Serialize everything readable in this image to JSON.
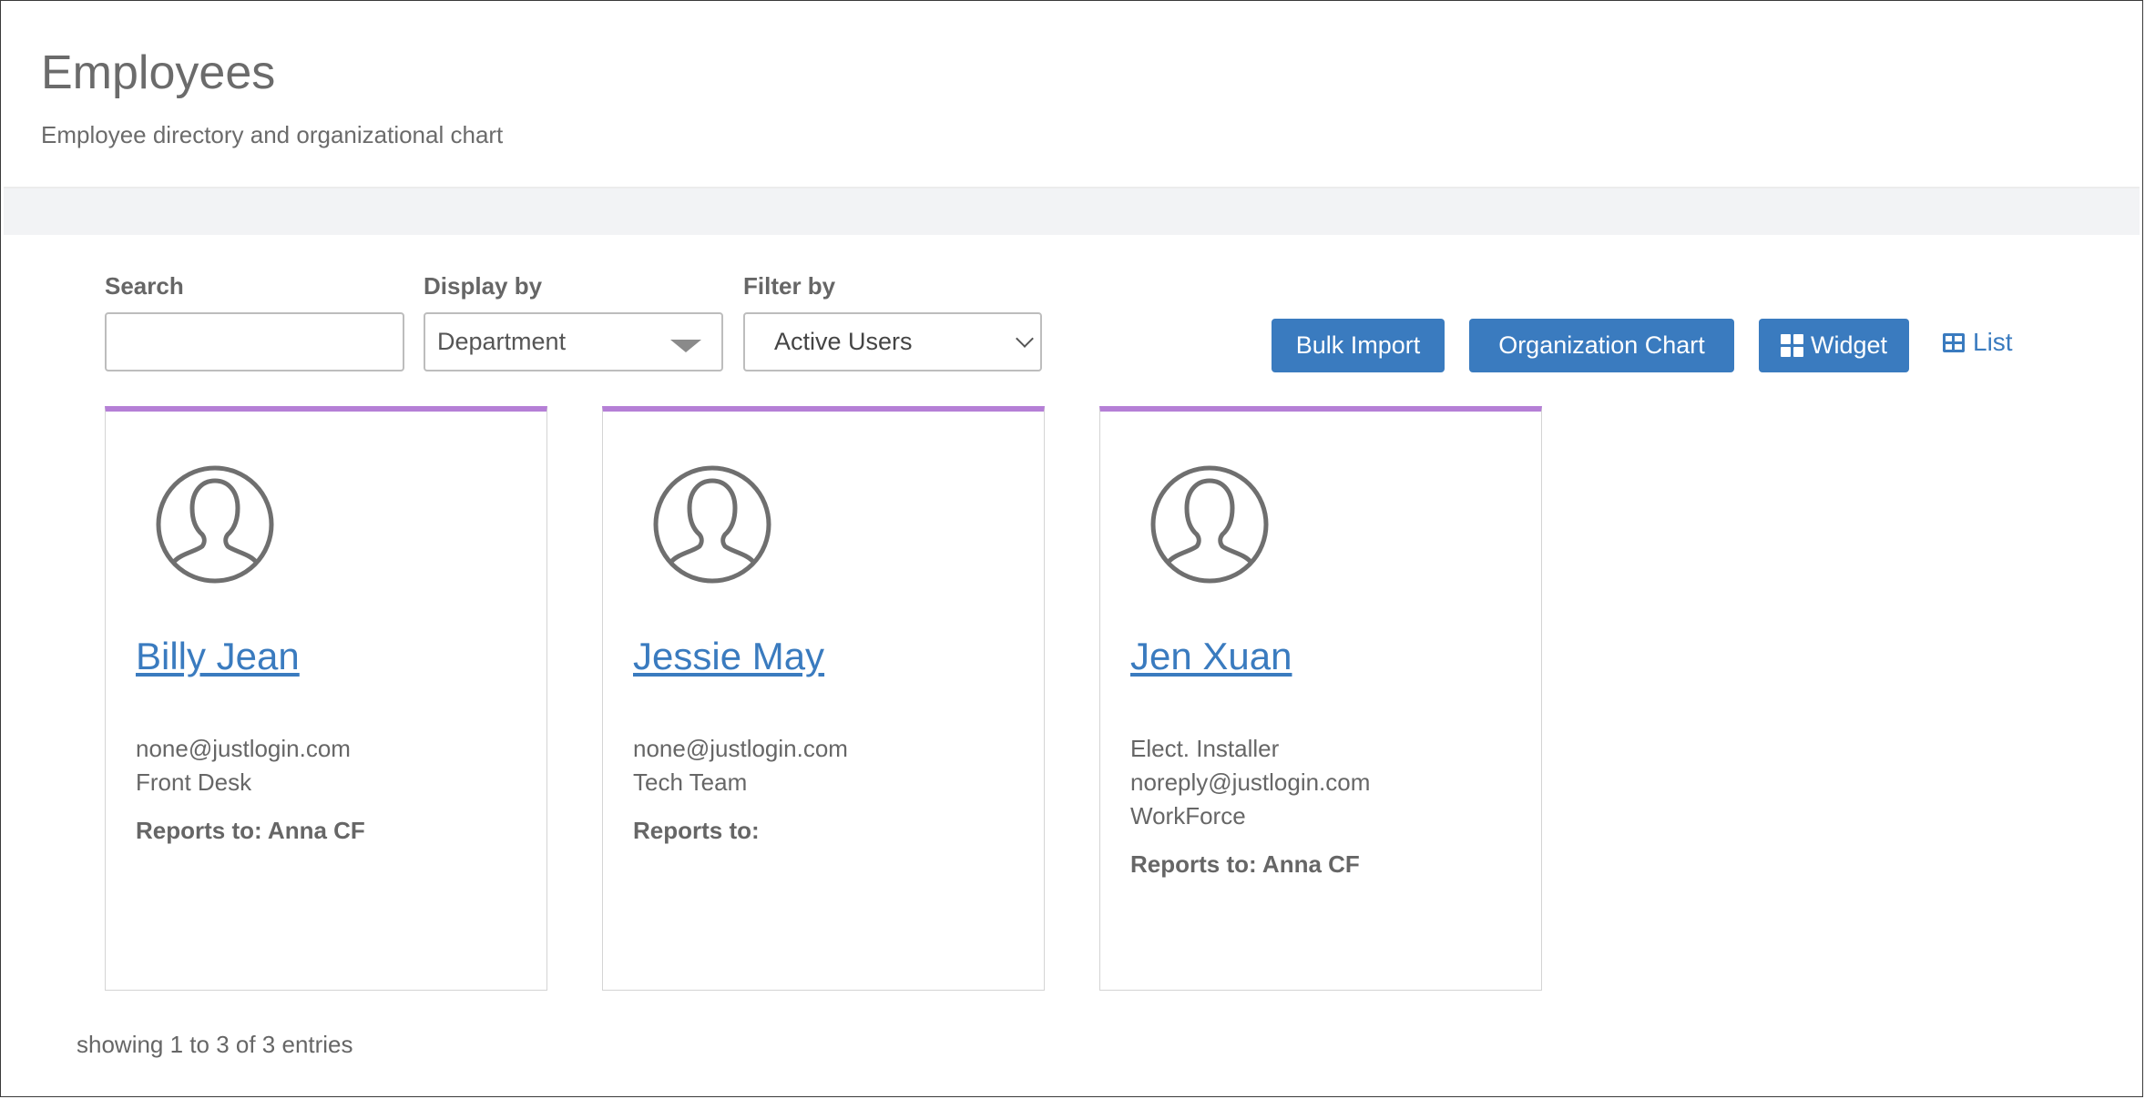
{
  "header": {
    "title": "Employees",
    "subtitle": "Employee directory and organizational chart"
  },
  "filters": {
    "search_label": "Search",
    "search_value": "",
    "display_label": "Display by",
    "display_value": "Department",
    "filter_label": "Filter by",
    "filter_value": "Active Users"
  },
  "toolbar": {
    "bulk_import": "Bulk Import",
    "org_chart": "Organization Chart",
    "widget": "Widget",
    "list": "List"
  },
  "colors": {
    "accent": "#3a7bbf",
    "card_top_border": "#b57fd6"
  },
  "employees": [
    {
      "name": "Billy Jean",
      "lines": [
        "none@justlogin.com",
        "Front Desk"
      ],
      "reports_to": "Reports to: Anna CF"
    },
    {
      "name": "Jessie May",
      "lines": [
        "none@justlogin.com",
        "Tech Team"
      ],
      "reports_to": "Reports to:"
    },
    {
      "name": "Jen Xuan",
      "lines": [
        "Elect. Installer",
        "noreply@justlogin.com",
        "WorkForce"
      ],
      "reports_to": "Reports to: Anna CF"
    }
  ],
  "footer": {
    "entries": "showing 1 to 3 of 3 entries"
  }
}
